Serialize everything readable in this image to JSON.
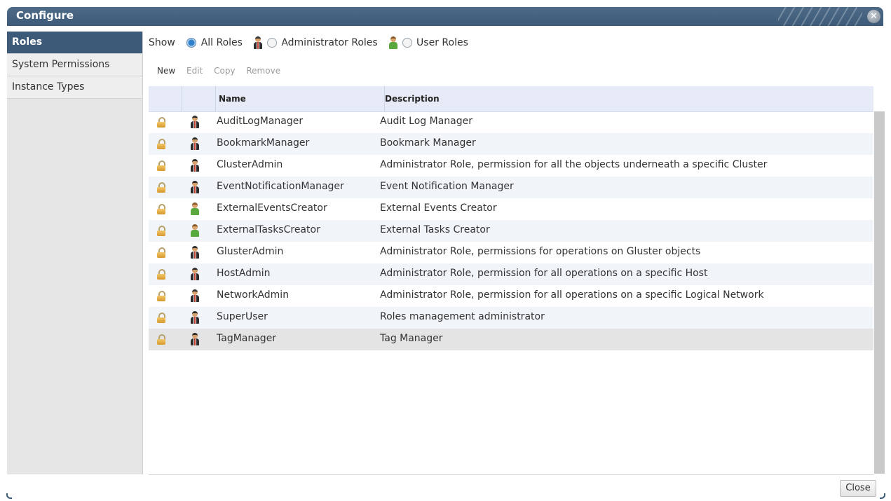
{
  "window": {
    "title": "Configure"
  },
  "sidebar": {
    "items": [
      {
        "label": "Roles",
        "active": true
      },
      {
        "label": "System Permissions",
        "active": false
      },
      {
        "label": "Instance Types",
        "active": false
      }
    ]
  },
  "filter": {
    "show_label": "Show",
    "options": [
      {
        "label": "All Roles",
        "selected": true
      },
      {
        "label": "Administrator Roles",
        "selected": false,
        "icon": "admin-icon"
      },
      {
        "label": "User Roles",
        "selected": false,
        "icon": "user-icon"
      }
    ]
  },
  "toolbar": {
    "new_label": "New",
    "edit_label": "Edit",
    "copy_label": "Copy",
    "remove_label": "Remove"
  },
  "table": {
    "columns": {
      "lock": "",
      "type": "",
      "name": "Name",
      "description": "Description"
    },
    "rows": [
      {
        "type": "admin",
        "name": "AuditLogManager",
        "description": "Audit Log Manager"
      },
      {
        "type": "admin",
        "name": "BookmarkManager",
        "description": "Bookmark Manager"
      },
      {
        "type": "admin",
        "name": "ClusterAdmin",
        "description": "Administrator Role, permission for all the objects underneath a specific Cluster"
      },
      {
        "type": "admin",
        "name": "EventNotificationManager",
        "description": "Event Notification Manager"
      },
      {
        "type": "user",
        "name": "ExternalEventsCreator",
        "description": "External Events Creator"
      },
      {
        "type": "user",
        "name": "ExternalTasksCreator",
        "description": "External Tasks Creator"
      },
      {
        "type": "admin",
        "name": "GlusterAdmin",
        "description": "Administrator Role, permissions for operations on Gluster objects"
      },
      {
        "type": "admin",
        "name": "HostAdmin",
        "description": "Administrator Role, permission for all operations on a specific Host"
      },
      {
        "type": "admin",
        "name": "NetworkAdmin",
        "description": "Administrator Role, permission for all operations on a specific Logical Network"
      },
      {
        "type": "admin",
        "name": "SuperUser",
        "description": "Roles management administrator"
      },
      {
        "type": "admin",
        "name": "TagManager",
        "description": "Tag Manager",
        "selected": true
      }
    ]
  },
  "footer": {
    "close_label": "Close"
  },
  "colors": {
    "titlebar": "#3d5a78",
    "active_nav": "#3d5a78",
    "header_bg": "#e7ebf7",
    "alt_row": "#f1f4f9"
  }
}
